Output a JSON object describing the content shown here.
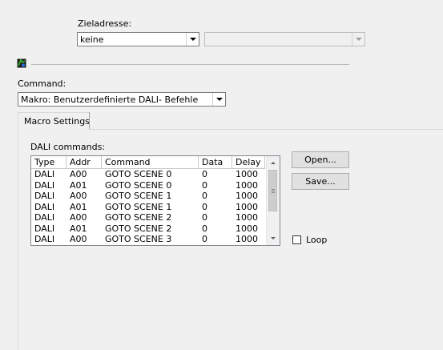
{
  "target": {
    "label": "Zieladresse:",
    "address_value": "keine",
    "secondary_value": ""
  },
  "command": {
    "label": "Command:",
    "value": "Makro:  Benutzerdefinierte DALI- Befehle"
  },
  "tabs": [
    {
      "label": "Macro Settings",
      "selected": true
    }
  ],
  "dali": {
    "group_label": "DALI commands:",
    "columns": [
      "Type",
      "Addr",
      "Command",
      "Data",
      "Delay"
    ],
    "rows": [
      [
        "DALI",
        "A00",
        "GOTO SCENE 0",
        "0",
        "1000"
      ],
      [
        "DALI",
        "A01",
        "GOTO SCENE 0",
        "0",
        "1000"
      ],
      [
        "DALI",
        "A00",
        "GOTO SCENE 1",
        "0",
        "1000"
      ],
      [
        "DALI",
        "A01",
        "GOTO SCENE 1",
        "0",
        "1000"
      ],
      [
        "DALI",
        "A00",
        "GOTO SCENE 2",
        "0",
        "1000"
      ],
      [
        "DALI",
        "A01",
        "GOTO SCENE 2",
        "0",
        "1000"
      ],
      [
        "DALI",
        "A00",
        "GOTO SCENE 3",
        "0",
        "1000"
      ]
    ]
  },
  "buttons": {
    "open": "Open...",
    "save": "Save..."
  },
  "loop": {
    "label": "Loop",
    "checked": false
  },
  "icons": {
    "app": "dali-config-icon",
    "dropdown": "chevron-down-icon"
  }
}
